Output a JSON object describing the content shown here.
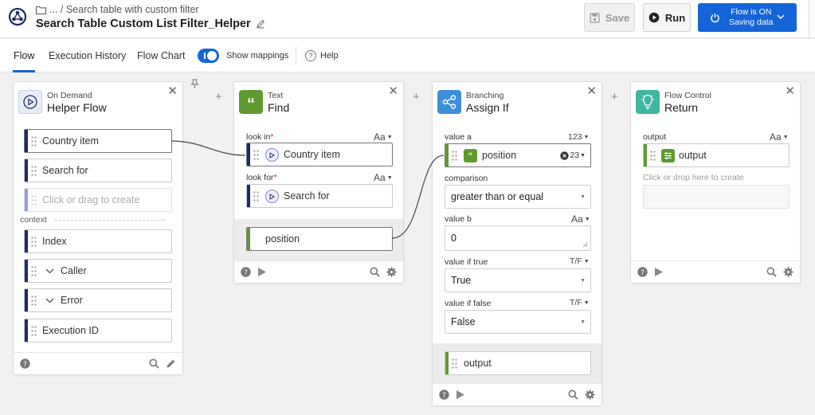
{
  "header": {
    "breadcrumb": "... / Search table with custom filter",
    "title": "Search Table Custom List Filter_Helper",
    "save_label": "Save",
    "run_label": "Run",
    "flow_status_line1": "Flow is ON",
    "flow_status_line2": "Saving data"
  },
  "tabs": {
    "flow": "Flow",
    "history": "Execution History",
    "chart": "Flow Chart",
    "mappings": "Show mappings",
    "help": "Help"
  },
  "cards": {
    "helper": {
      "category": "On Demand",
      "name": "Helper Flow",
      "inputs": [
        "Country item",
        "Search for"
      ],
      "create_placeholder": "Click or drag to create",
      "context_label": "context",
      "context_items": [
        "Index",
        "Caller",
        "Error",
        "Execution ID"
      ]
    },
    "find": {
      "category": "Text",
      "name": "Find",
      "look_in_label": "look in",
      "look_in_value": "Country item",
      "look_in_type": "Aa",
      "look_for_label": "look for",
      "look_for_value": "Search for",
      "look_for_type": "Aa",
      "output": "position"
    },
    "assign": {
      "category": "Branching",
      "name": "Assign If",
      "value_a_label": "value a",
      "value_a_type": "123",
      "value_a_value": "position",
      "value_a_badge": "23",
      "comparison_label": "comparison",
      "comparison_value": "greater than or equal",
      "value_b_label": "value b",
      "value_b_type": "Aa",
      "value_b_value": "0",
      "if_true_label": "value if true",
      "if_true_type": "T/F",
      "if_true_value": "True",
      "if_false_label": "value if false",
      "if_false_type": "T/F",
      "if_false_value": "False",
      "output": "output"
    },
    "ret": {
      "category": "Flow Control",
      "name": "Return",
      "output_label": "output",
      "output_type": "Aa",
      "output_value": "output",
      "create_hint": "Click or drop here to create"
    }
  },
  "colors": {
    "accent": "#1665d8",
    "green": "#5e9b2e",
    "node_blue": "#3d8fd9",
    "node_dark": "#1c2b66"
  }
}
